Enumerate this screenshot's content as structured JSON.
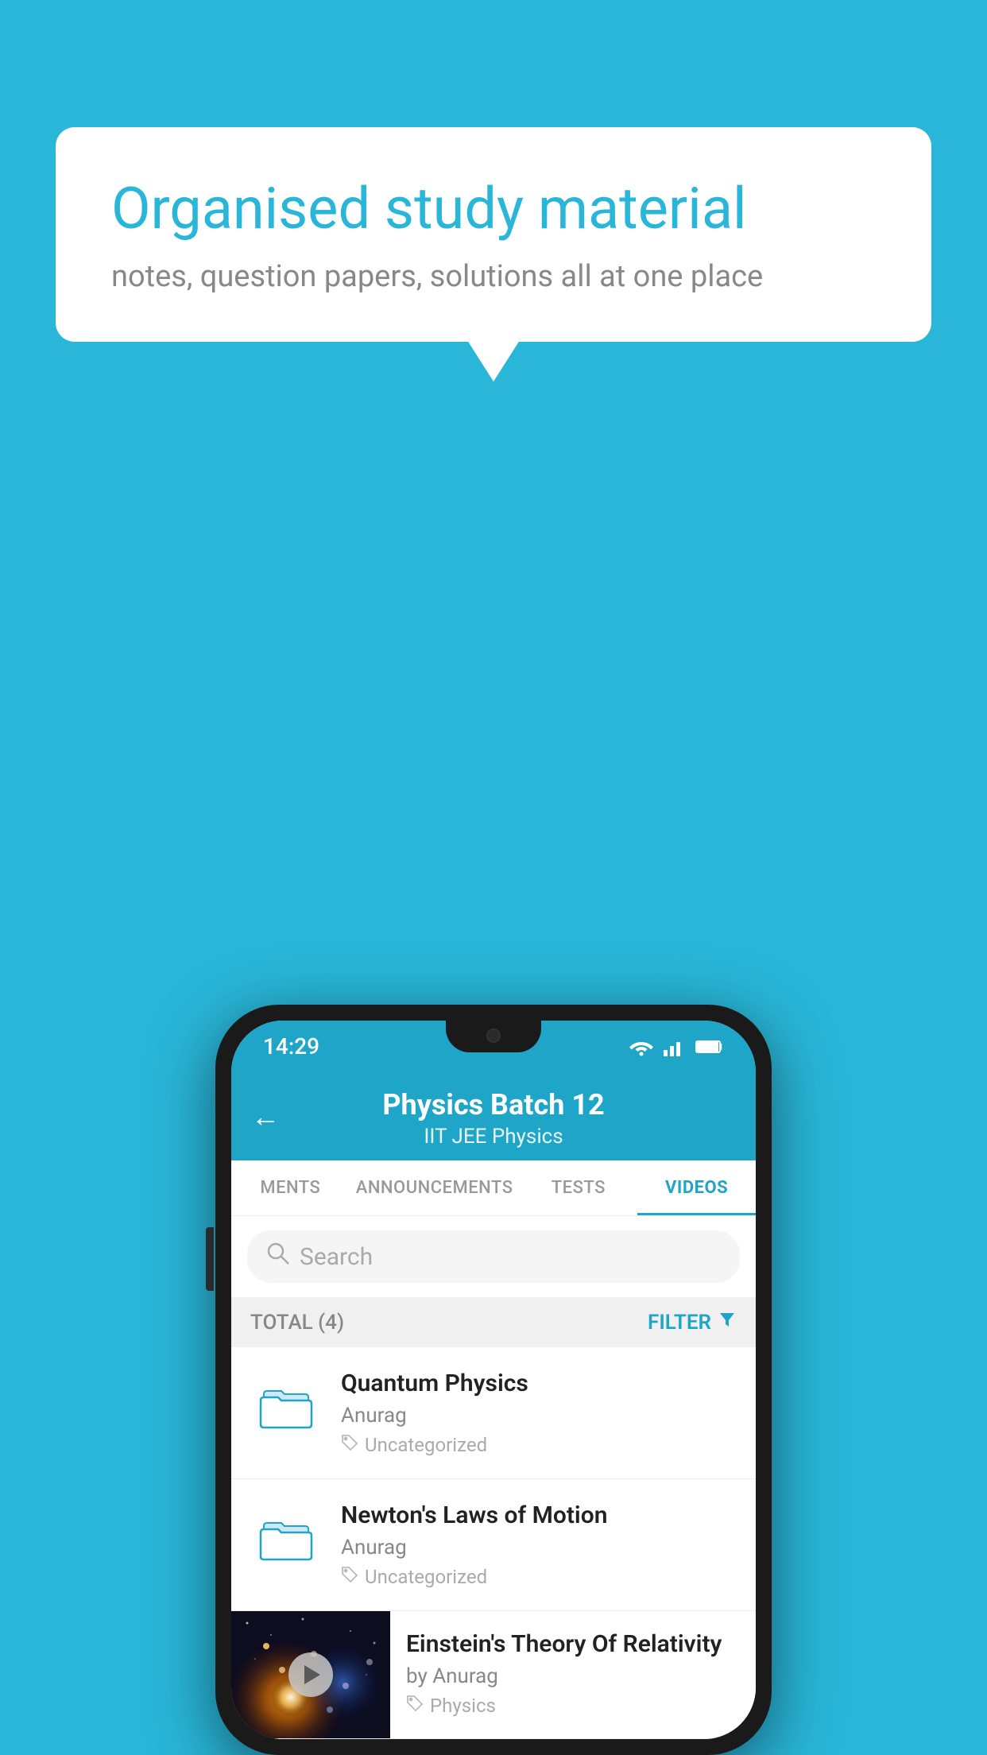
{
  "background_color": "#29b6d8",
  "speech_bubble": {
    "title": "Organised study material",
    "subtitle": "notes, question papers, solutions all at one place"
  },
  "phone": {
    "status_bar": {
      "time": "14:29"
    },
    "header": {
      "back_label": "←",
      "title": "Physics Batch 12",
      "subtitle": "IIT JEE   Physics"
    },
    "tabs": [
      {
        "label": "MENTS",
        "active": false
      },
      {
        "label": "ANNOUNCEMENTS",
        "active": false
      },
      {
        "label": "TESTS",
        "active": false
      },
      {
        "label": "VIDEOS",
        "active": true
      }
    ],
    "search": {
      "placeholder": "Search"
    },
    "filter_row": {
      "total_label": "TOTAL (4)",
      "filter_label": "FILTER"
    },
    "videos": [
      {
        "title": "Quantum Physics",
        "author": "Anurag",
        "tag": "Uncategorized",
        "type": "folder"
      },
      {
        "title": "Newton's Laws of Motion",
        "author": "Anurag",
        "tag": "Uncategorized",
        "type": "folder"
      },
      {
        "title": "Einstein's Theory Of Relativity",
        "author": "by Anurag",
        "tag": "Physics",
        "type": "video"
      }
    ]
  }
}
